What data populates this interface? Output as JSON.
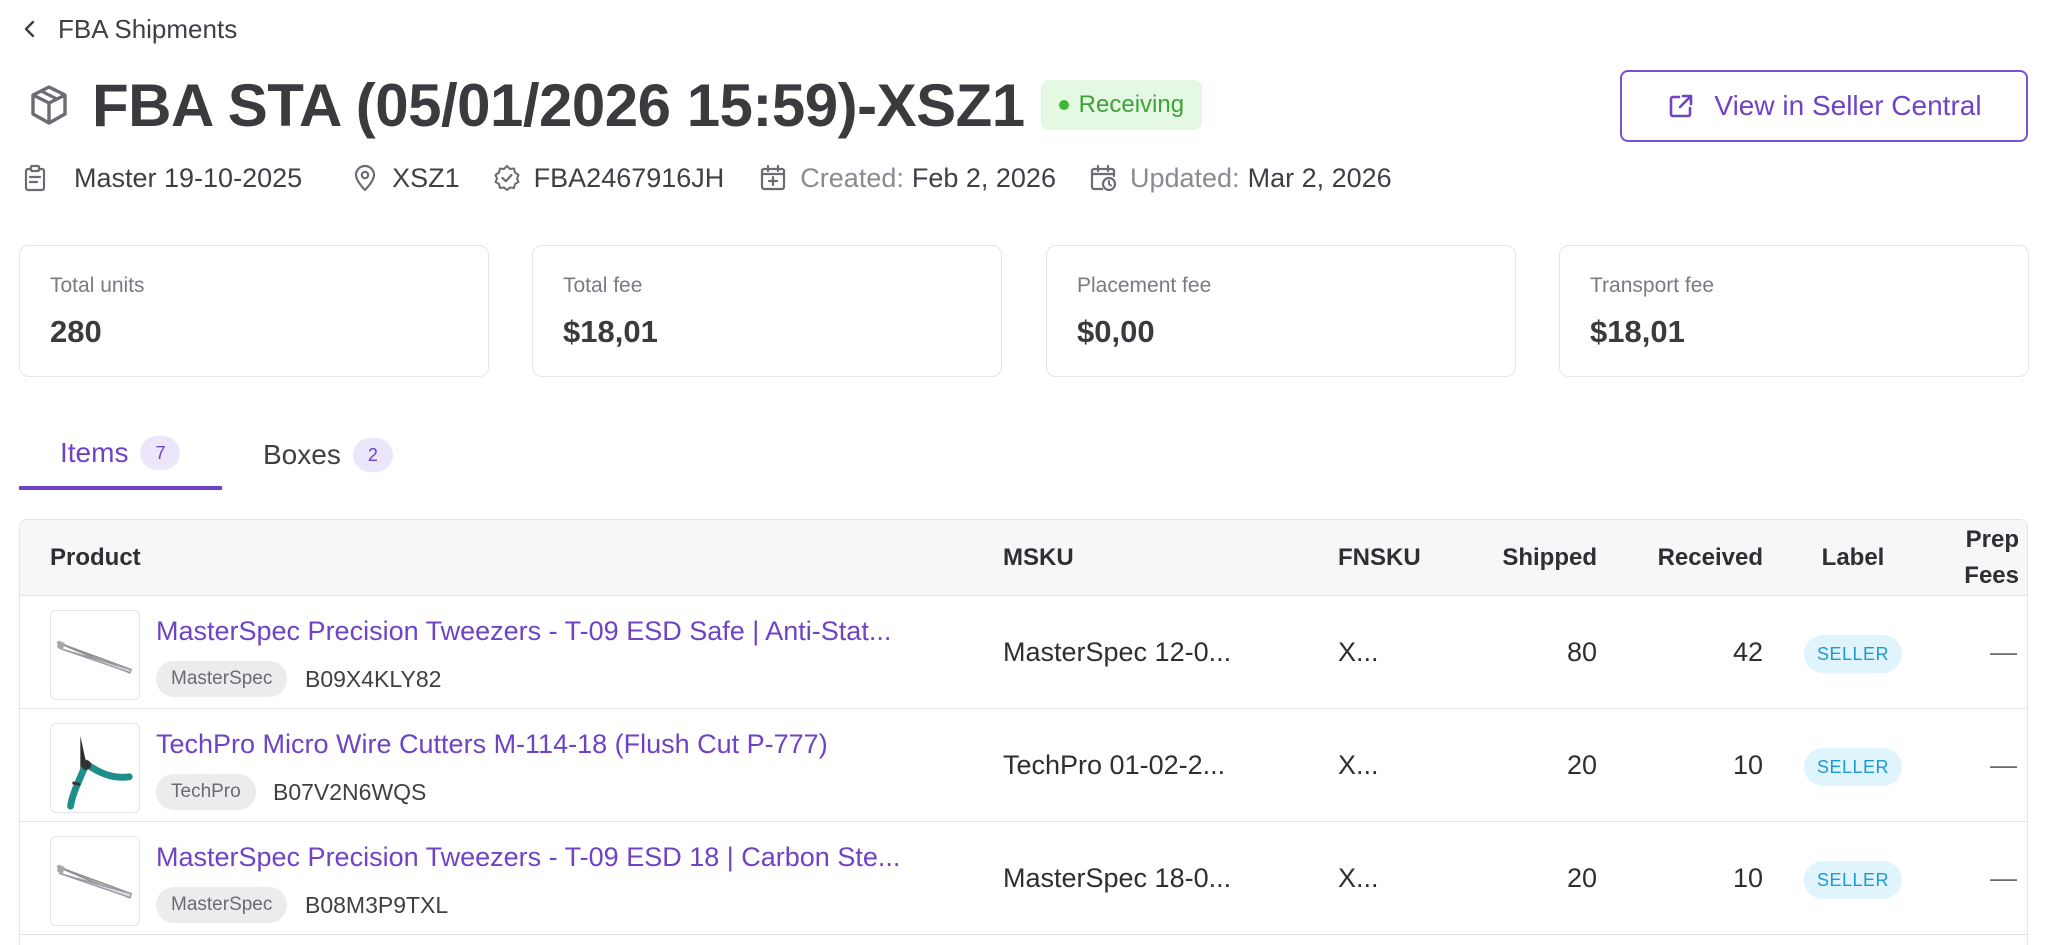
{
  "breadcrumb": {
    "back_label": "FBA Shipments"
  },
  "header": {
    "title": "FBA STA (05/01/2026 15:59)-XSZ1",
    "status": "Receiving",
    "seller_central_button": "View in Seller Central"
  },
  "meta": {
    "plan": "Master 19-10-2025",
    "destination": "XSZ1",
    "shipment_id": "FBA2467916JH",
    "created_label": "Created:",
    "created_value": "Feb 2, 2026",
    "updated_label": "Updated:",
    "updated_value": "Mar 2, 2026"
  },
  "stats": [
    {
      "label": "Total units",
      "value": "280"
    },
    {
      "label": "Total fee",
      "value": "$18,01"
    },
    {
      "label": "Placement fee",
      "value": "$0,00"
    },
    {
      "label": "Transport fee",
      "value": "$18,01"
    }
  ],
  "tabs": [
    {
      "label": "Items",
      "count": "7",
      "active": true
    },
    {
      "label": "Boxes",
      "count": "2",
      "active": false
    }
  ],
  "table": {
    "columns": {
      "product": "Product",
      "msku": "MSKU",
      "fnsku": "FNSKU",
      "shipped": "Shipped",
      "received": "Received",
      "label": "Label",
      "prep_fees_1": "Prep",
      "prep_fees_2": "Fees"
    },
    "rows": [
      {
        "name": "MasterSpec Precision Tweezers - T-09 ESD Safe | Anti-Stat...",
        "brand": "MasterSpec",
        "asin": "B09X4KLY82",
        "msku": "MasterSpec 12-0...",
        "fnsku": "X...",
        "shipped": "80",
        "received": "42",
        "label": "SELLER",
        "prep_fees": "—"
      },
      {
        "name": "TechPro Micro Wire Cutters M-114-18 (Flush Cut P-777)",
        "brand": "TechPro",
        "asin": "B07V2N6WQS",
        "msku": "TechPro 01-02-2...",
        "fnsku": "X...",
        "shipped": "20",
        "received": "10",
        "label": "SELLER",
        "prep_fees": "—"
      },
      {
        "name": "MasterSpec Precision Tweezers - T-09 ESD 18 | Carbon Ste...",
        "brand": "MasterSpec",
        "asin": "B08M3P9TXL",
        "msku": "MasterSpec 18-0...",
        "fnsku": "X...",
        "shipped": "20",
        "received": "10",
        "label": "SELLER",
        "prep_fees": "—"
      }
    ]
  },
  "colors": {
    "accent": "#6e43c6",
    "status_green": "#3ea238",
    "label_blue": "#1b9ad6"
  },
  "icons": [
    "chevron-left-icon",
    "package-icon",
    "external-link-icon",
    "clipboard-icon",
    "map-pin-icon",
    "verified-badge-icon",
    "calendar-plus-icon",
    "calendar-clock-icon",
    "tweezers-icon",
    "wire-cutter-icon"
  ]
}
